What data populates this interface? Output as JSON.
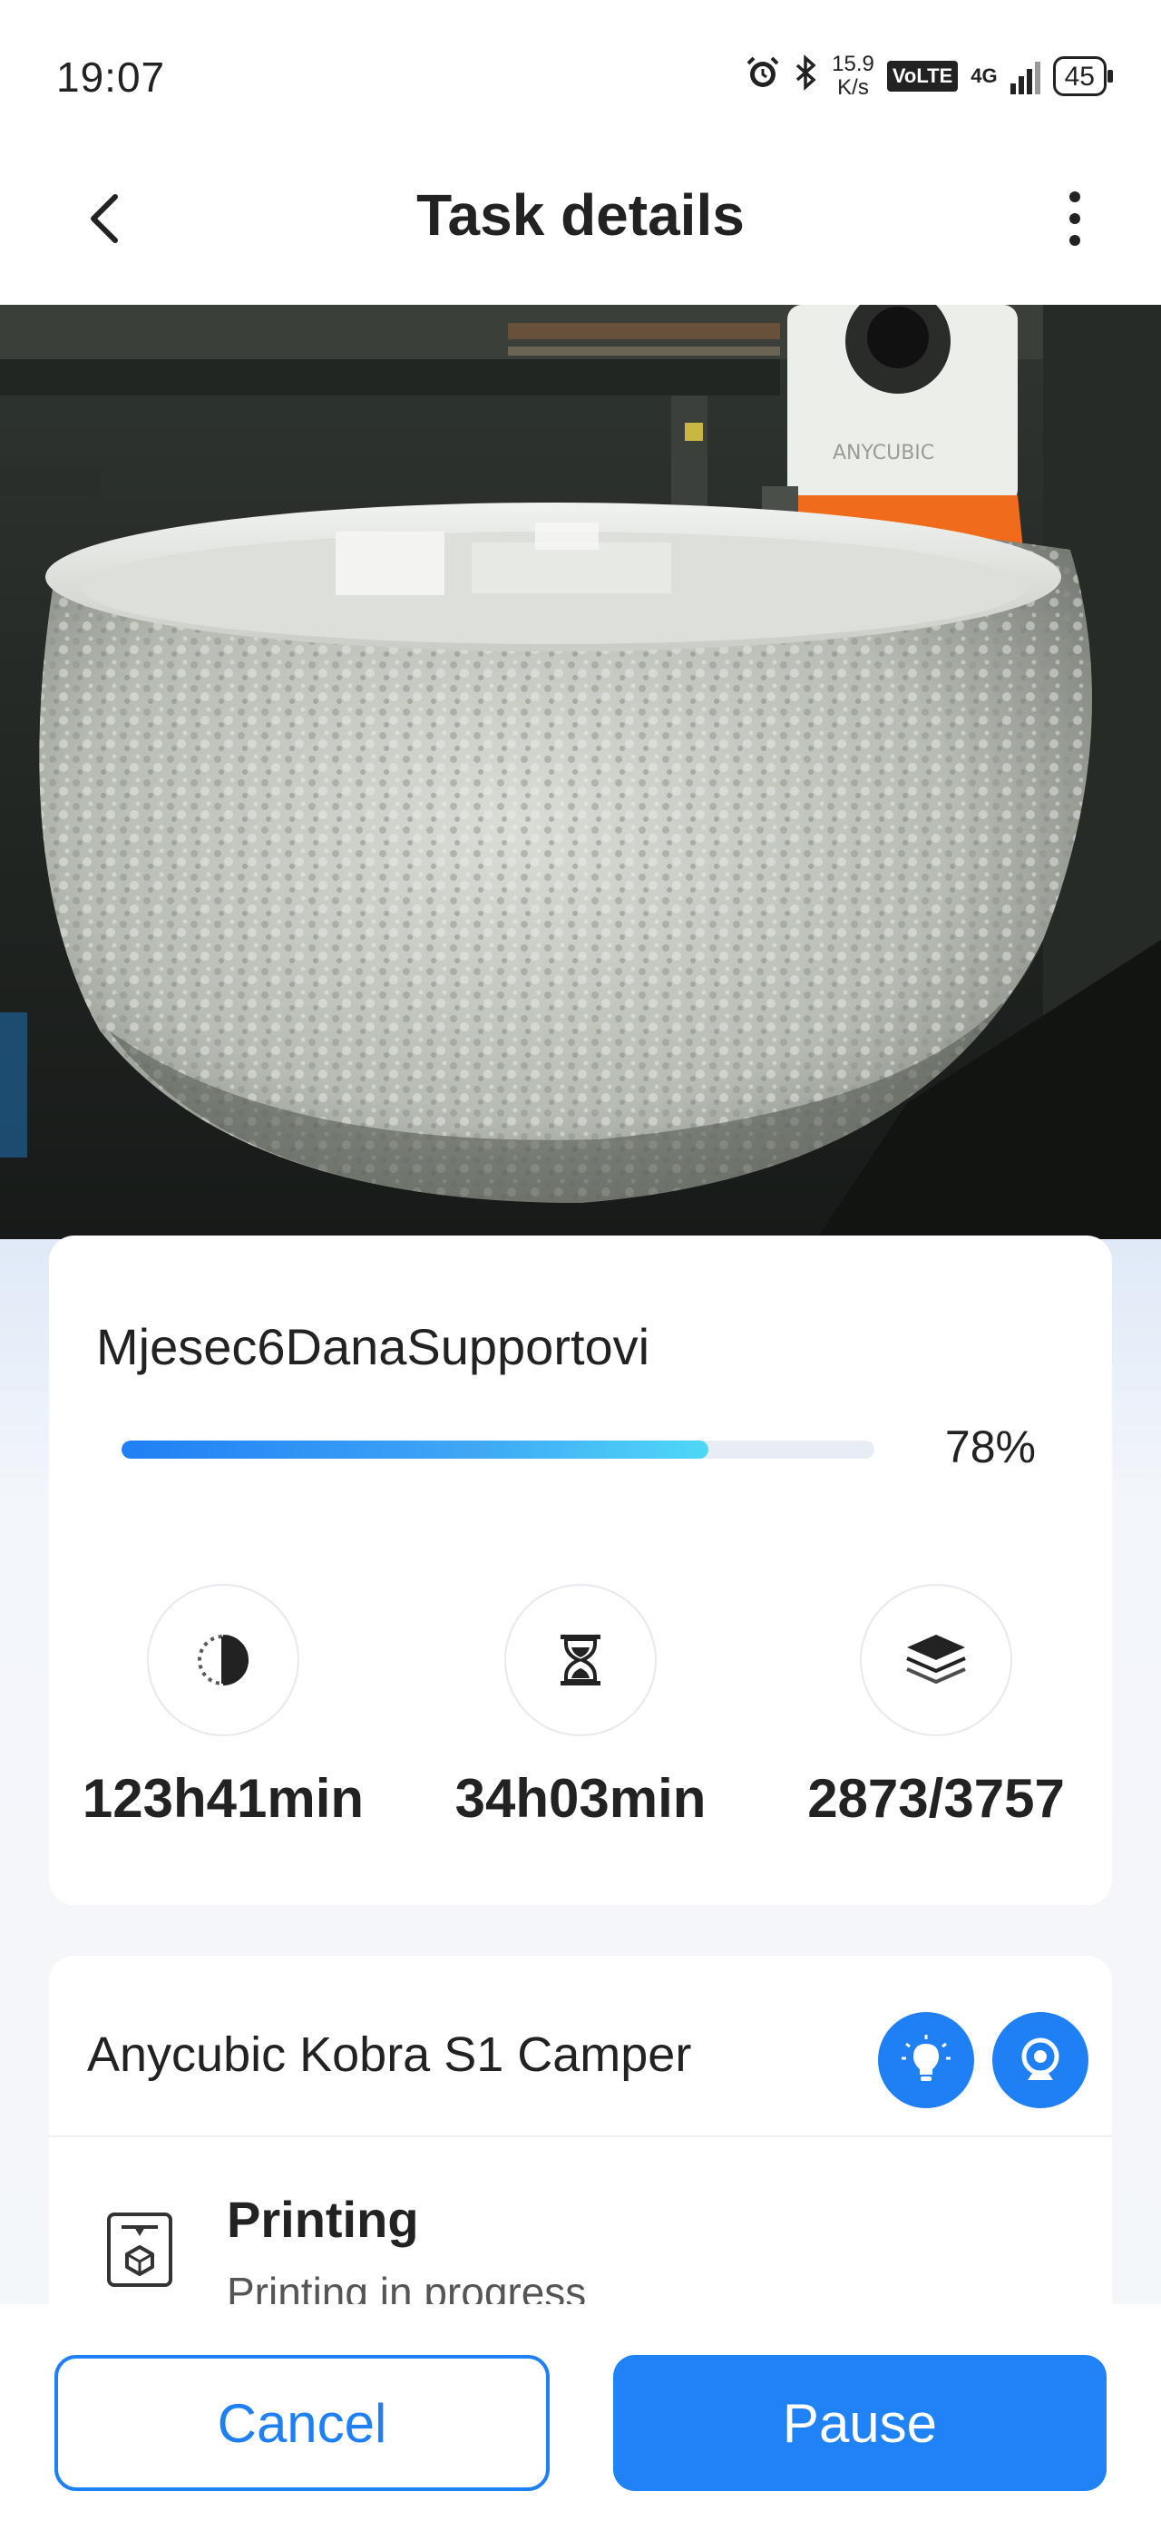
{
  "status_bar": {
    "time": "19:07",
    "speed_value": "15.9",
    "speed_unit": "K/s",
    "volte": "VoLTE",
    "network": "4G",
    "battery": "45",
    "icons": [
      "alarm-icon",
      "bluetooth-icon",
      "signal-icon",
      "battery-icon"
    ]
  },
  "header": {
    "title": "Task details",
    "back_icon": "chevron-left-icon",
    "more_icon": "more-vertical-icon"
  },
  "camera": {
    "description_icon": "camera-feed",
    "label_on_printhead": "ANYCUBIC"
  },
  "task": {
    "name": "Mjesec6DanaSupportovi",
    "progress_percent": 78,
    "progress_label": "78%",
    "stats": [
      {
        "icon": "elapsed-time-icon",
        "value": "123h41min"
      },
      {
        "icon": "hourglass-icon",
        "value": "34h03min"
      },
      {
        "icon": "layers-icon",
        "value": "2873/3757"
      }
    ]
  },
  "printer": {
    "name": "Anycubic Kobra S1 Camper",
    "light_icon": "lightbulb-icon",
    "camera_icon": "webcam-icon",
    "status_icon": "printer-status-icon",
    "status_title": "Printing",
    "status_subtitle": "Printing in progress"
  },
  "actions": {
    "cancel_label": "Cancel",
    "pause_label": "Pause"
  },
  "colors": {
    "accent": "#1f7ff5",
    "progress_end": "#4fd8f6",
    "text": "#222222"
  }
}
